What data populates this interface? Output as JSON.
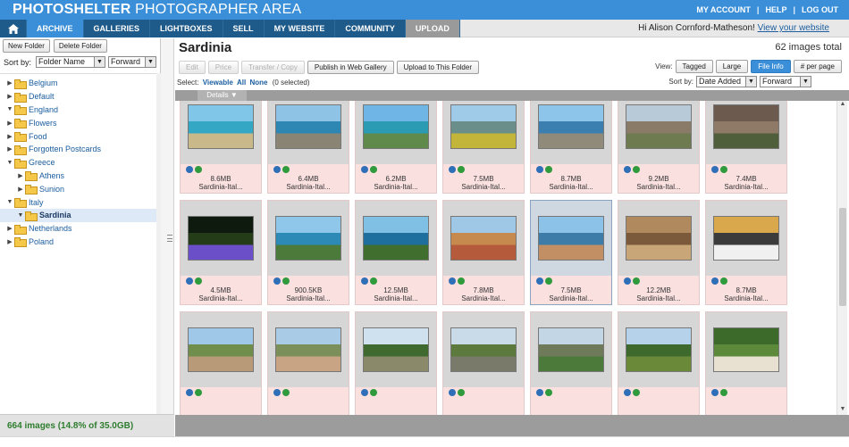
{
  "header": {
    "logo_bold": "PHOTOSHELTER",
    "logo_light": "PHOTOGRAPHER AREA",
    "links": [
      "MY ACCOUNT",
      "HELP",
      "LOG OUT"
    ],
    "greeting": "Hi Alison Cornford-Matheson!",
    "view_site": "View your website"
  },
  "nav": {
    "tabs": [
      "ARCHIVE",
      "GALLERIES",
      "LIGHTBOXES",
      "SELL",
      "MY WEBSITE",
      "COMMUNITY",
      "UPLOAD"
    ]
  },
  "left": {
    "new_folder": "New Folder",
    "delete_folder": "Delete Folder",
    "sort_label": "Sort by:",
    "sort_value": "Folder Name",
    "order_value": "Forward",
    "tree": [
      {
        "label": "Belgium",
        "level": 0,
        "open": false
      },
      {
        "label": "Default",
        "level": 0,
        "open": false
      },
      {
        "label": "England",
        "level": 0,
        "open": true
      },
      {
        "label": "Flowers",
        "level": 0,
        "open": false
      },
      {
        "label": "Food",
        "level": 0,
        "open": false
      },
      {
        "label": "Forgotten Postcards",
        "level": 0,
        "open": false
      },
      {
        "label": "Greece",
        "level": 0,
        "open": true
      },
      {
        "label": "Athens",
        "level": 1,
        "open": false
      },
      {
        "label": "Sunion",
        "level": 1,
        "open": false
      },
      {
        "label": "Italy",
        "level": 0,
        "open": true
      },
      {
        "label": "Sardinia",
        "level": 1,
        "open": true,
        "selected": true
      },
      {
        "label": "Netherlands",
        "level": 0,
        "open": false
      },
      {
        "label": "Poland",
        "level": 0,
        "open": false
      }
    ],
    "status": "664 images (14.8% of 35.0GB)"
  },
  "main": {
    "title": "Sardinia",
    "total": "62 images total",
    "toolbar": {
      "edit": "Edit",
      "price": "Price",
      "transfer": "Transfer / Copy",
      "publish": "Publish in Web Gallery",
      "upload": "Upload to This Folder"
    },
    "view": {
      "label": "View:",
      "tagged": "Tagged",
      "large": "Large",
      "fileinfo": "File Info",
      "perpage": "# per page"
    },
    "select": {
      "label": "Select:",
      "viewable": "Viewable",
      "all": "All",
      "none": "None",
      "count": "(0 selected)"
    },
    "sortby": {
      "label": "Sort by:",
      "value": "Date Added",
      "order": "Forward"
    },
    "details_label": "Details ▼",
    "rows": [
      [
        {
          "size": "8.6MB",
          "name": "Sardinia-Ital...",
          "colors": [
            "#7fc6e8",
            "#34a7c4",
            "#c9b98a"
          ]
        },
        {
          "size": "6.4MB",
          "name": "Sardinia-Ital...",
          "colors": [
            "#8fc3e6",
            "#2e86b3",
            "#8a8474"
          ]
        },
        {
          "size": "6.2MB",
          "name": "Sardinia-Ital...",
          "colors": [
            "#6fb6e6",
            "#2b9bb4",
            "#5f8a4c"
          ]
        },
        {
          "size": "7.5MB",
          "name": "Sardinia-Ital...",
          "colors": [
            "#9fcbe8",
            "#6a8f8a",
            "#c3b53a"
          ]
        },
        {
          "size": "8.7MB",
          "name": "Sardinia-Ital...",
          "colors": [
            "#8cc4ea",
            "#3b7fb0",
            "#8f8a7a"
          ]
        },
        {
          "size": "9.2MB",
          "name": "Sardinia-Ital...",
          "colors": [
            "#b8c9d8",
            "#8a7a68",
            "#6e7a4f"
          ]
        },
        {
          "size": "7.4MB",
          "name": "Sardinia-Ital...",
          "colors": [
            "#6d5a4e",
            "#8e7a66",
            "#4f5e3b"
          ]
        }
      ],
      [
        {
          "size": "4.5MB",
          "name": "Sardinia-Ital...",
          "colors": [
            "#0d1a0d",
            "#243d18",
            "#6a4fc8"
          ]
        },
        {
          "size": "900.5KB",
          "name": "Sardinia-Ital...",
          "colors": [
            "#8ec7ea",
            "#2d8ab6",
            "#4c7a3a"
          ]
        },
        {
          "size": "12.5MB",
          "name": "Sardinia-Ital...",
          "colors": [
            "#7fc0e4",
            "#1f6f9e",
            "#3f6e2f"
          ]
        },
        {
          "size": "7.8MB",
          "name": "Sardinia-Ital...",
          "colors": [
            "#9fc7e6",
            "#c68a4e",
            "#b55a3a"
          ]
        },
        {
          "size": "7.5MB",
          "name": "Sardinia-Ital...",
          "colors": [
            "#8cc2e8",
            "#3d7ca8",
            "#c28f64"
          ]
        },
        {
          "size": "12.2MB",
          "name": "Sardinia-Ital...",
          "colors": [
            "#b08a5e",
            "#7a5a3a",
            "#c9a678"
          ]
        },
        {
          "size": "8.7MB",
          "name": "Sardinia-Ital...",
          "colors": [
            "#d9a84c",
            "#3b3b3b",
            "#f0f0f0"
          ]
        }
      ],
      [
        {
          "size": "",
          "name": "",
          "colors": [
            "#9fc8e8",
            "#6f8e4c",
            "#b89a78"
          ]
        },
        {
          "size": "",
          "name": "",
          "colors": [
            "#a9cbe6",
            "#7a8f5a",
            "#c8a484"
          ]
        },
        {
          "size": "",
          "name": "",
          "colors": [
            "#cfe0ee",
            "#3f6a2f",
            "#8a8a6a"
          ]
        },
        {
          "size": "",
          "name": "",
          "colors": [
            "#c9dbe8",
            "#5d7a3e",
            "#7a7a6a"
          ]
        },
        {
          "size": "",
          "name": "",
          "colors": [
            "#c2d6e6",
            "#6f7a5a",
            "#4c7a3a"
          ]
        },
        {
          "size": "",
          "name": "",
          "colors": [
            "#b6d2ea",
            "#3d6a2c",
            "#6a8a3a"
          ]
        },
        {
          "size": "",
          "name": "",
          "colors": [
            "#3c6a2a",
            "#5d8a3a",
            "#e8e0d0"
          ]
        }
      ]
    ]
  }
}
